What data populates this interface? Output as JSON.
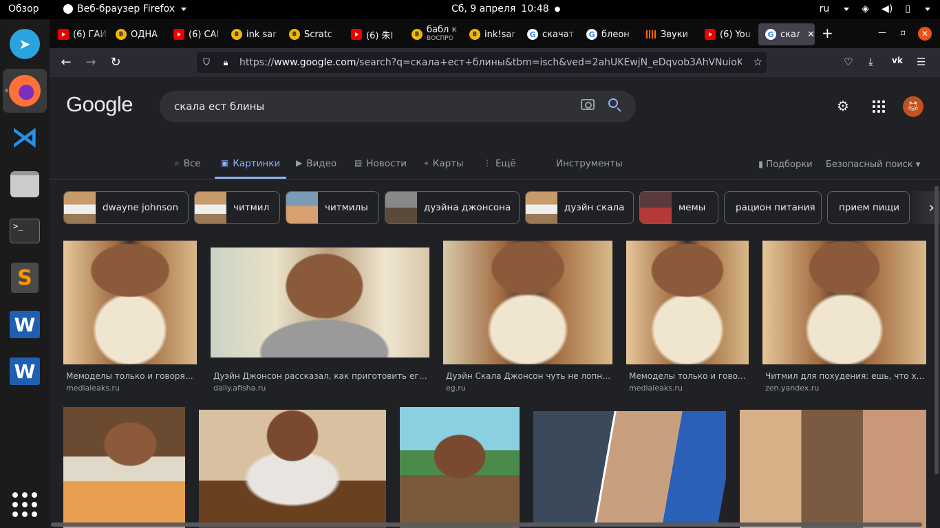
{
  "topbar": {
    "activities": "Обзор",
    "app_menu": "Веб-браузер Firefox",
    "date": "Сб, 9 апреля",
    "time": "10:48",
    "keyboard_layout": "ru"
  },
  "dock": {
    "items": [
      "telegram-icon",
      "firefox-icon",
      "vscode-icon",
      "files-icon",
      "terminal-icon",
      "sublime-icon",
      "word-icon",
      "word-icon"
    ],
    "terminal_glyph": ">_",
    "word_glyph": "W"
  },
  "browser": {
    "tabs": [
      {
        "label": "(6) ГАЙ",
        "icon": "yt"
      },
      {
        "label": "ОДНА",
        "icon": "ink"
      },
      {
        "label": "(6) CAI",
        "icon": "yt"
      },
      {
        "label": "ink sar",
        "icon": "ink"
      },
      {
        "label": "Scratc",
        "icon": "ink"
      },
      {
        "label": "(6) 朱I",
        "icon": "yt"
      },
      {
        "label": "бабл к",
        "sub": "ВОСПРО",
        "icon": "ink"
      },
      {
        "label": "ink!sar",
        "icon": "ink"
      },
      {
        "label": "скачат",
        "icon": "g"
      },
      {
        "label": "блеон",
        "icon": "g"
      },
      {
        "label": "Звуки",
        "icon": "snd"
      },
      {
        "label": "(6) You",
        "icon": "yt"
      },
      {
        "label": "скал",
        "icon": "g",
        "active": true
      }
    ],
    "url_prefix": "https://",
    "url_domain": "www.google.com",
    "url_rest": "/search?q=скала+ест+блины&tbm=isch&ved=2ahUKEwjN_eDqvob3AhVNuioKH"
  },
  "google": {
    "logo": "Google",
    "query": "скала ест блины",
    "tabs": [
      "Все",
      "Картинки",
      "Видео",
      "Новости",
      "Карты",
      "Ещё"
    ],
    "tools": "Инструменты",
    "collections": "Подборки",
    "safe_search": "Безопасный поиск",
    "chips": [
      "dwayne johnson",
      "читмил",
      "читмилы",
      "дуэйна джонсона",
      "дуэйн скала",
      "мемы",
      "рацион питания",
      "прием пищи"
    ],
    "results": [
      {
        "caption": "Мемоделы только и говорят, ...",
        "source": "medialeaks.ru"
      },
      {
        "caption": "Дуэйн Джонсон рассказал, как приготовить его лю...",
        "source": "daily.afisha.ru"
      },
      {
        "caption": "Дуэйн Скала Джонсон чуть не лопнул -...",
        "source": "eg.ru"
      },
      {
        "caption": "Мемоделы только и говоря...",
        "source": "medialeaks.ru"
      },
      {
        "caption": "Читмил для похудения: ешь, что хоче...",
        "source": "zen.yandex.ru"
      }
    ]
  },
  "colors": {
    "page_bg": "#202124",
    "link_blue": "#8ab4f8",
    "tabbar_bg": "#0c0c0d",
    "accent_orange": "#e95420"
  }
}
